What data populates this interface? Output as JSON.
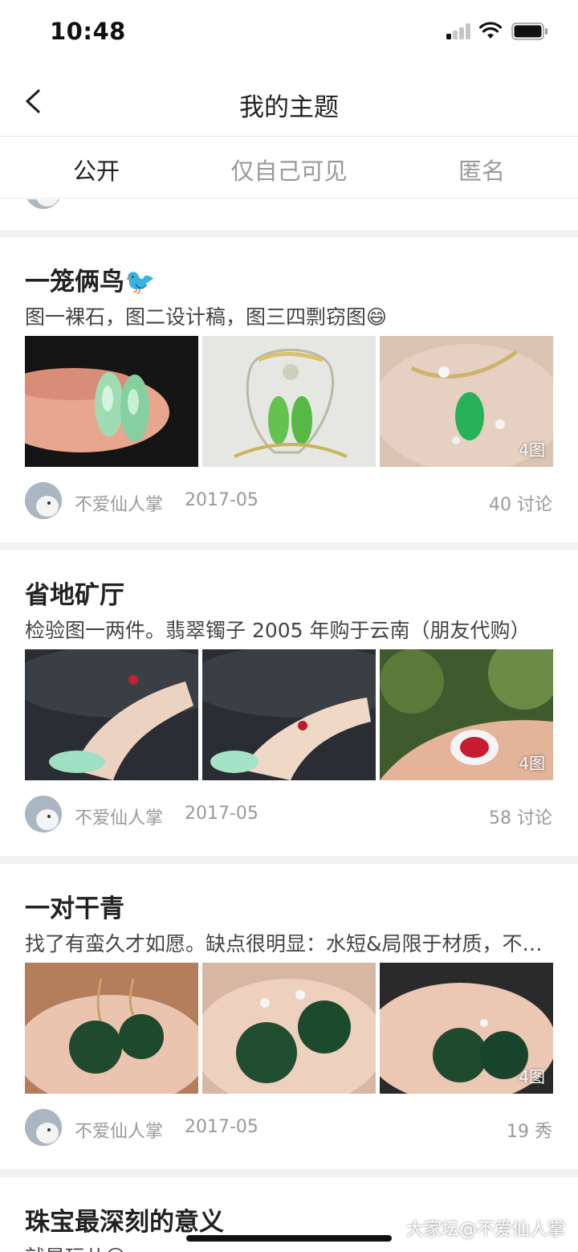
{
  "status_bar": {
    "time": "10:48"
  },
  "nav": {
    "title": "我的主题"
  },
  "tabs": [
    {
      "label": "公开",
      "active": true
    },
    {
      "label": "仅自己可见",
      "active": false
    },
    {
      "label": "匿名",
      "active": false
    }
  ],
  "posts": [
    {
      "title": "一笼俩鸟🐦",
      "summary": "图一裸石，图二设计稿，图三四剽窃图😄",
      "image_count": "4图",
      "author": "不爱仙人掌",
      "date": "2017-05",
      "count": "40 讨论"
    },
    {
      "title": "省地矿厅",
      "summary": "检验图一两件。翡翠镯子 2005 年购于云南（朋友代购）",
      "image_count": "4图",
      "author": "不爱仙人掌",
      "date": "2017-05",
      "count": "58 讨论"
    },
    {
      "title": "一对干青",
      "summary": "找了有蛮久才如愿。缺点很明显：水短&局限于材质，不够透亮",
      "image_count": "4图",
      "author": "不爱仙人掌",
      "date": "2017-05",
      "count": "19 秀"
    },
    {
      "title": "珠宝最深刻的意义",
      "summary": "就是玩儿😄"
    }
  ],
  "watermark": "大家坛@不爱仙人掌"
}
